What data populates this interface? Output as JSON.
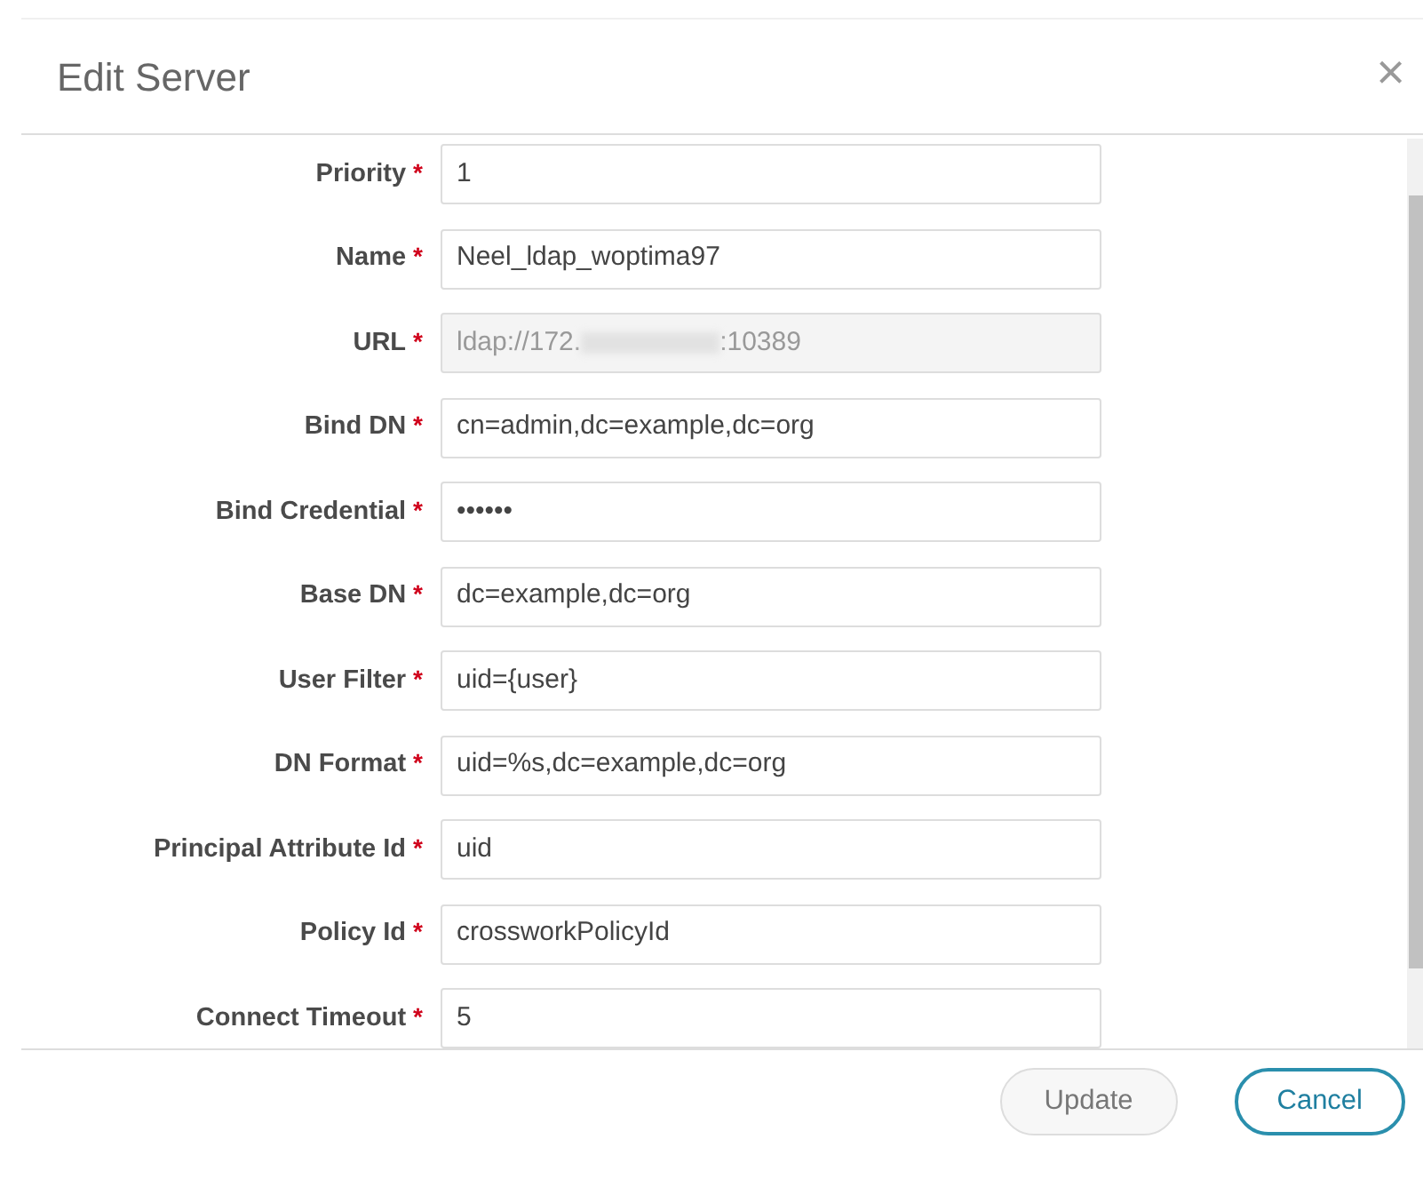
{
  "dialog": {
    "title": "Edit Server",
    "close": "×"
  },
  "fields": [
    {
      "label": "Priority",
      "required_mark": "*",
      "disabled": false,
      "value": [
        {
          "kind": "text",
          "text": "1"
        }
      ]
    },
    {
      "label": "Name",
      "required_mark": "*",
      "disabled": false,
      "value": [
        {
          "kind": "text",
          "text": "Neel_ldap_woptima97"
        }
      ]
    },
    {
      "label": "URL",
      "required_mark": "*",
      "disabled": true,
      "value": [
        {
          "kind": "text",
          "text": "ldap://172."
        },
        {
          "kind": "redacted"
        },
        {
          "kind": "text",
          "text": ":10389"
        }
      ]
    },
    {
      "label": "Bind DN",
      "required_mark": "*",
      "disabled": false,
      "value": [
        {
          "kind": "text",
          "text": "cn=admin,dc=example,dc=org"
        }
      ]
    },
    {
      "label": "Bind Credential",
      "required_mark": "*",
      "disabled": false,
      "value": [
        {
          "kind": "text",
          "text": "••••••"
        }
      ]
    },
    {
      "label": "Base DN",
      "required_mark": "*",
      "disabled": false,
      "value": [
        {
          "kind": "text",
          "text": "dc=example,dc=org"
        }
      ]
    },
    {
      "label": "User Filter",
      "required_mark": "*",
      "disabled": false,
      "value": [
        {
          "kind": "text",
          "text": "uid={user}"
        }
      ]
    },
    {
      "label": "DN Format",
      "required_mark": "*",
      "disabled": false,
      "value": [
        {
          "kind": "text",
          "text": "uid=%s,dc=example,dc=org"
        }
      ]
    },
    {
      "label": "Principal Attribute Id",
      "required_mark": "*",
      "disabled": false,
      "value": [
        {
          "kind": "text",
          "text": "uid"
        }
      ]
    },
    {
      "label": "Policy Id",
      "required_mark": "*",
      "disabled": false,
      "value": [
        {
          "kind": "text",
          "text": "crossworkPolicyId"
        }
      ]
    },
    {
      "label": "Connect Timeout",
      "required_mark": "*",
      "disabled": false,
      "value": [
        {
          "kind": "text",
          "text": "5"
        }
      ]
    }
  ],
  "buttons": [
    {
      "label": "Update",
      "disabled": true
    },
    {
      "label": "Cancel",
      "disabled": false
    }
  ]
}
